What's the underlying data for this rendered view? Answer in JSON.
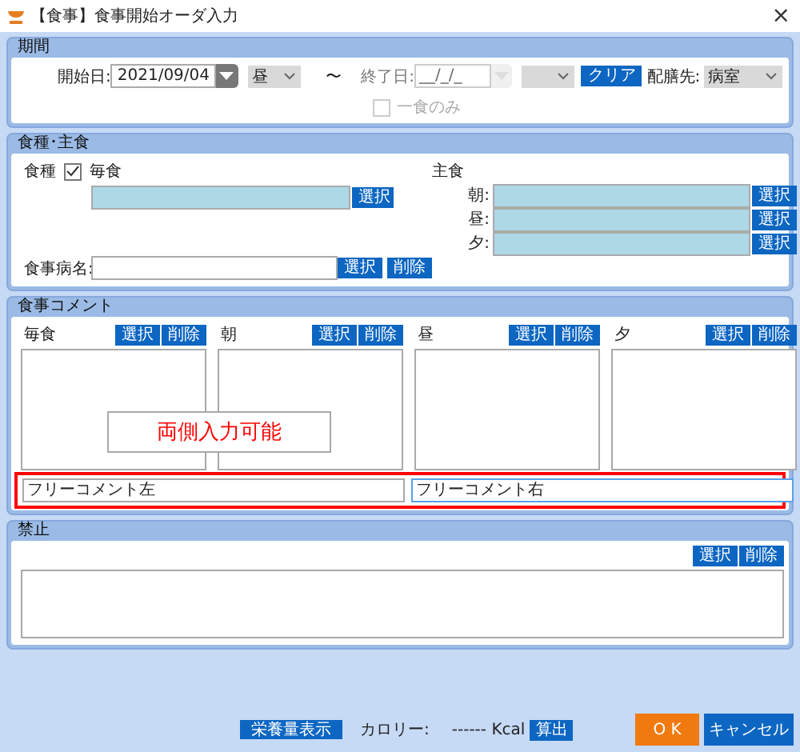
{
  "window": {
    "title": "【食事】食事開始オーダ入力",
    "close": "×"
  },
  "period": {
    "title": "期間",
    "start_label": "開始日:",
    "start_date": "2021/09/04",
    "start_meal": "昼",
    "tilde": "〜",
    "end_label": "終了日:",
    "end_date": "__/_/_",
    "end_disabled": true,
    "clear": "クリア",
    "ward_label": "配膳先:",
    "ward": "病室",
    "one_meal": {
      "label": "一食のみ",
      "checked": false,
      "disabled": true
    }
  },
  "meal_type": {
    "title": "食種･主食",
    "label": "食種",
    "every_meal": {
      "label": "毎食",
      "checked": true
    },
    "select": "選択",
    "staple_label": "主食",
    "staples": [
      {
        "label": "朝:",
        "button": "選択"
      },
      {
        "label": "昼:",
        "button": "選択"
      },
      {
        "label": "夕:",
        "button": "選択"
      }
    ],
    "disease_label": "食事病名:",
    "disease_buttons": [
      "選択",
      "削除"
    ]
  },
  "comments": {
    "title": "食事コメント",
    "columns": [
      {
        "label": "毎食",
        "buttons": [
          "選択",
          "削除"
        ]
      },
      {
        "label": "朝",
        "buttons": [
          "選択",
          "削除"
        ]
      },
      {
        "label": "昼",
        "buttons": [
          "選択",
          "削除"
        ]
      },
      {
        "label": "夕",
        "buttons": [
          "選択",
          "削除"
        ]
      }
    ],
    "free": [
      {
        "value": "フリーコメント左",
        "focused": false
      },
      {
        "value": "フリーコメント右",
        "focused": true
      }
    ],
    "note": "両側入力可能"
  },
  "prohibition": {
    "title": "禁止",
    "buttons": [
      "選択",
      "削除"
    ]
  },
  "footer": {
    "nutrition": "栄養量表示",
    "calorie_label": "カロリー:",
    "calorie_value": "------ Kcal",
    "calc": "算出",
    "ok": "O K",
    "cancel": "キャンセル"
  }
}
